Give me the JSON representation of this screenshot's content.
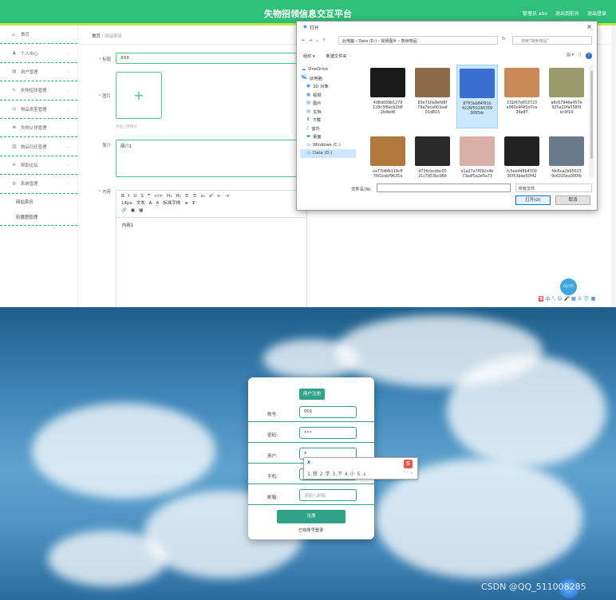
{
  "header": {
    "title": "失物招领信息交互平台",
    "user": "管理员 abo",
    "back_label": "退出到前台",
    "logout_label": "退出登录"
  },
  "sidebar": {
    "items": [
      {
        "label": "首页",
        "icon": "home-icon",
        "glyph": "⌂"
      },
      {
        "label": "个人中心",
        "icon": "user-icon",
        "glyph": "♟"
      },
      {
        "label": "用户管理",
        "icon": "users-icon",
        "glyph": "▤"
      },
      {
        "label": "失物招领管理",
        "icon": "pin-icon",
        "glyph": "✎"
      },
      {
        "label": "物品类型管理",
        "icon": "tag-icon",
        "glyph": "◎"
      },
      {
        "label": "失物认领管理",
        "icon": "flag-icon",
        "glyph": "⚑"
      },
      {
        "label": "物品归还管理",
        "icon": "chart-icon",
        "glyph": "▥"
      },
      {
        "label": "帮助论坛",
        "icon": "send-icon",
        "glyph": "➤"
      },
      {
        "label": "系统管理",
        "icon": "gear-icon",
        "glyph": "⚙"
      }
    ],
    "subitems": [
      {
        "label": "网站资讯"
      },
      {
        "label": "轮播图管理"
      }
    ]
  },
  "breadcrumb": {
    "home": "首页",
    "sep": "/",
    "current": "网站资讯"
  },
  "form": {
    "title_label": "标题",
    "title_value": "XXX",
    "image_label": "图片",
    "upload_hint": "点击上传图片",
    "upload_plus": "+",
    "intro_label": "简介",
    "intro_value": "简介1",
    "content_label": "内容",
    "content_value": "内容1",
    "toolbar_row1": [
      "B",
      "I",
      "U",
      "S",
      "❞",
      "</>",
      "H₁",
      "H₂",
      "☰",
      "☰",
      "x₂",
      "x²",
      "⇤",
      "⇥"
    ],
    "toolbar_row2": [
      "14px",
      "文本",
      "A",
      "A̲",
      "标准字体",
      "≡",
      "T̶"
    ],
    "toolbar_row3": [
      "🔗",
      "▣",
      "▦"
    ]
  },
  "clock": "02:55",
  "file_dialog": {
    "title": "打开",
    "path": [
      "此电脑",
      "Data (D:)",
      "视频图片",
      "随身物品"
    ],
    "search_placeholder": "搜索\"随身物品\"",
    "organize": "组织 ▾",
    "new_folder": "新建文件夹",
    "tree": [
      {
        "label": "OneDrive",
        "glyph": "☁"
      },
      {
        "label": "此电脑",
        "glyph": "🖳"
      },
      {
        "label": "3D 对象",
        "glyph": "▣"
      },
      {
        "label": "视频",
        "glyph": "▦"
      },
      {
        "label": "图片",
        "glyph": "▨"
      },
      {
        "label": "文档",
        "glyph": "▤"
      },
      {
        "label": "下载",
        "glyph": "⬇"
      },
      {
        "label": "音乐",
        "glyph": "♪"
      },
      {
        "label": "桌面",
        "glyph": "▬"
      },
      {
        "label": "Windows (C:)",
        "glyph": "▭"
      },
      {
        "label": "Data (D:)",
        "glyph": "▭"
      }
    ],
    "files": [
      {
        "name": "4d8dd39b1279 128c3f8ecb2fdf 2b4bd6",
        "color": "#1a1a1a"
      },
      {
        "name": "83e710a9efd6f 79a7bca003aaf 01d815",
        "color": "#8c6a4a"
      },
      {
        "name": "87ff3ab84f91b 4226f50246769 3695dc",
        "color": "#3a6fd0"
      },
      {
        "name": "331f67e653723 a960c4f4f1d7ce 34a87",
        "color": "#c98a5a"
      },
      {
        "name": "a6c67946e457e 925a10fa558f3 ec9f14",
        "color": "#9a9a6a"
      },
      {
        "name": "ca77d4fb119cff 7fd1cebf9635a",
        "color": "#b07a3e"
      },
      {
        "name": "d736cbcebc00 21c7d53bc966",
        "color": "#2a2a2a"
      },
      {
        "name": "e1a27a7f092c4b 73adf5a2e5a73",
        "color": "#d8b0a8"
      },
      {
        "name": "fc5ee448b4300 95f53bae50f42",
        "color": "#222222"
      },
      {
        "name": "fdc6ca2b95023 9c6315ea300fb",
        "color": "#6a7a8a"
      }
    ],
    "filename_label": "文件名(N):",
    "filetype": "所有文件",
    "open_label": "打开(O)",
    "cancel_label": "取消"
  },
  "taskbar_ime": [
    "S",
    "中",
    "°,",
    "☺",
    "🎤",
    "▦",
    "♙",
    "👕",
    "▦"
  ],
  "register": {
    "title": "用户注册",
    "fields": [
      {
        "label": "账号:",
        "value": "001",
        "placeholder": ""
      },
      {
        "label": "密码:",
        "value": "•••",
        "placeholder": ""
      },
      {
        "label": "用户:",
        "value": "x",
        "placeholder": ""
      },
      {
        "label": "手机:",
        "value": "",
        "placeholder": ""
      },
      {
        "label": "邮箱:",
        "value": "",
        "placeholder": "请输入邮箱"
      }
    ],
    "submit": "注册",
    "login_link": "已有账号登录"
  },
  "ime": {
    "input": "x",
    "candidates": "1.想  2.学  3.下  4.小  5.↓",
    "nav": "‹ › ⌄",
    "logo": "S"
  },
  "watermark": "CSDN @QQ_511008285",
  "colors": {
    "header": "#2fc07a",
    "accent": "#2fa387",
    "dialog_select": "#cce8ff"
  }
}
